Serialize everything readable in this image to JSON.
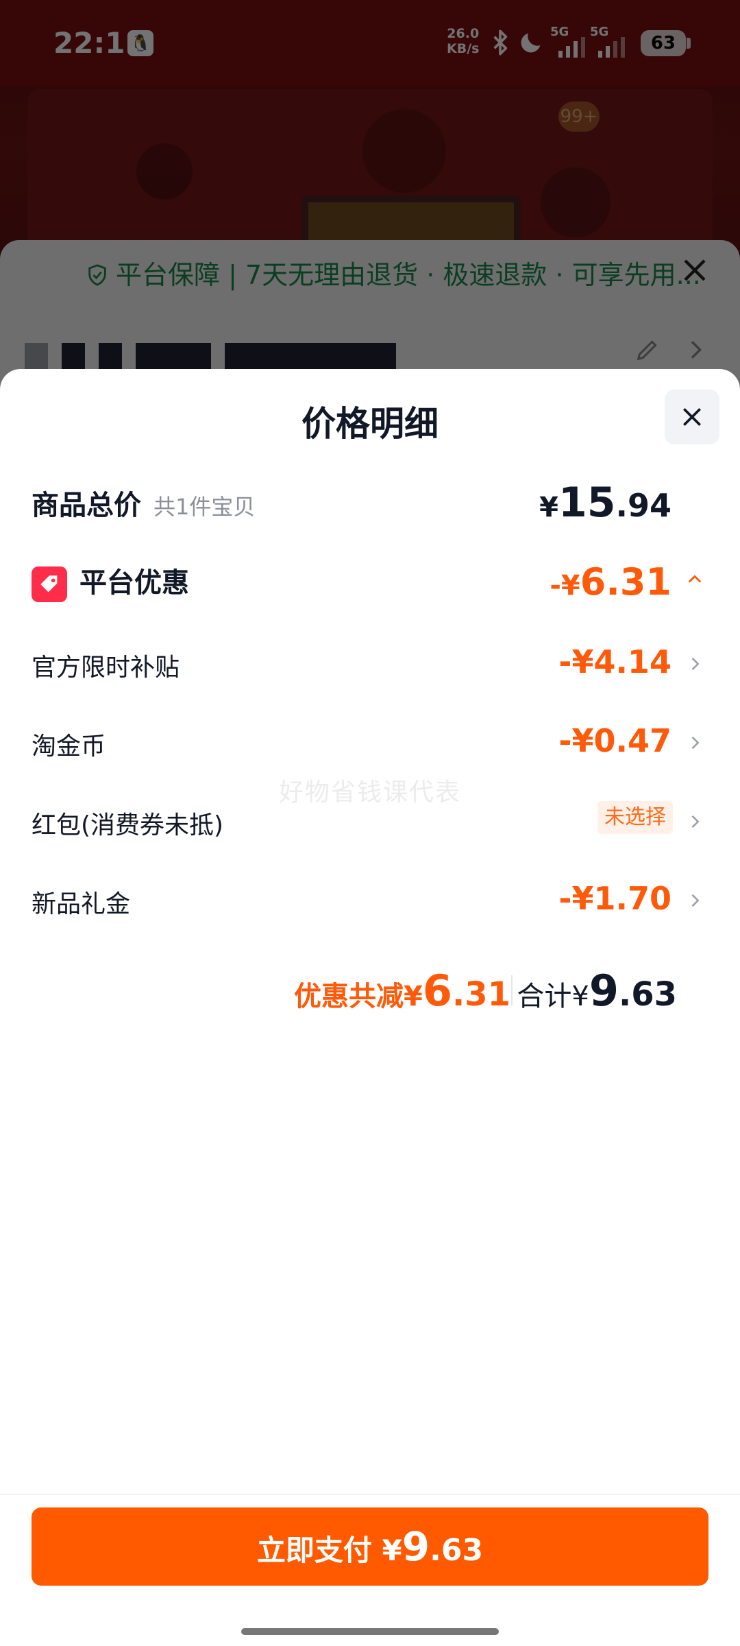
{
  "status_bar": {
    "time": "22:11",
    "speed_value": "26.0",
    "speed_unit": "KB/s",
    "network1": "5G",
    "network2": "5G",
    "battery": "63"
  },
  "background_sheet": {
    "guarantee_text": "平台保障 | 7天无理由退货 · 极速退款 · 可享先用...",
    "badge": "99+"
  },
  "sheet": {
    "title": "价格明细",
    "total": {
      "label": "商品总价",
      "sub": "共1件宝贝",
      "currency": "¥",
      "int": "15",
      "dec": ".94"
    },
    "platform": {
      "label": "平台优惠",
      "amount_prefix": "-¥",
      "amount": "6.31"
    },
    "items": [
      {
        "label": "官方限时补贴",
        "amount": "-¥4.14"
      },
      {
        "label": "淘金币",
        "amount": "-¥0.47"
      },
      {
        "label": "红包(消费券未抵)",
        "pill": "未选择"
      },
      {
        "label": "新品礼金",
        "amount": "-¥1.70"
      }
    ],
    "watermark": "好物省钱课代表",
    "summary": {
      "discount_label": "优惠共减¥",
      "discount_int": "6",
      "discount_dec": ".31",
      "total_label": "合计¥",
      "total_int": "9",
      "total_dec": ".63"
    },
    "pay": {
      "label": "立即支付 ¥",
      "int": "9",
      "dec": ".63"
    }
  },
  "colors": {
    "accent": "#ff5a0a",
    "pay_button": "#ff5a00",
    "tag_red": "#ff2d4a",
    "guarantee_green": "#1a8a4a"
  }
}
